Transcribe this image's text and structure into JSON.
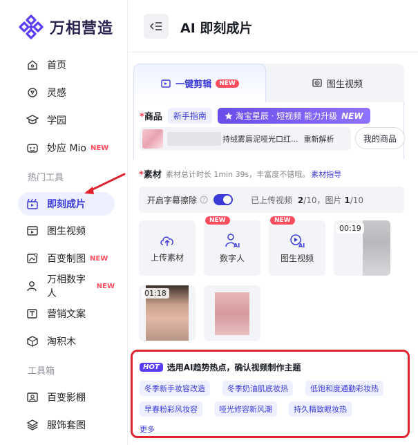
{
  "brand": {
    "name": "万相营造",
    "accent": "#3b3bd8"
  },
  "sidebar": {
    "items": [
      {
        "label": "首页",
        "icon": "home-icon"
      },
      {
        "label": "灵感",
        "icon": "bulb-icon"
      },
      {
        "label": "学园",
        "icon": "graduation-icon"
      },
      {
        "label": "妙应 Mio",
        "icon": "robot-icon",
        "badge": "NEW"
      }
    ],
    "section_hot": "热门工具",
    "hot_items": [
      {
        "label": "即刻成片",
        "icon": "clapper-icon",
        "active": true
      },
      {
        "label": "图生视频",
        "icon": "image-video-icon"
      },
      {
        "label": "百变制图",
        "icon": "image-edit-icon",
        "badge": "NEW"
      },
      {
        "label": "万相数字人",
        "icon": "person-icon",
        "badge": "NEW"
      },
      {
        "label": "营销文案",
        "icon": "text-icon"
      },
      {
        "label": "淘积木",
        "icon": "cube-icon"
      }
    ],
    "section_tools": "工具箱",
    "tool_items": [
      {
        "label": "百变影棚",
        "icon": "studio-icon"
      },
      {
        "label": "服饰套图",
        "icon": "layers-icon"
      }
    ]
  },
  "header": {
    "title": "AI 即刻成片"
  },
  "tabs": [
    {
      "label": "一键剪辑",
      "badge": "NEW"
    },
    {
      "label": "图生视频"
    }
  ],
  "goods": {
    "label": "商品",
    "guide": "新手指南",
    "promo": "淘宝星辰 · 短视频 能力升级",
    "promo_badge": "NEW",
    "product_name": "持绒雾唇泥哑光口红...",
    "reparse": "重新解析",
    "my_goods": "我的商品"
  },
  "material": {
    "label": "素材",
    "hint": "素材总计时长 1min 39s，丰富度不错哦。",
    "link": "素材指导",
    "subtitle_toggle": "开启字幕擦除",
    "uploaded_prefix": "已上传视频",
    "video_count": "2",
    "video_total": "/10，图片",
    "image_count": "1",
    "image_total": "/10"
  },
  "tiles": [
    {
      "label": "上传素材"
    },
    {
      "label": "数字人",
      "badge": "NEW"
    },
    {
      "label": "图生视频",
      "badge": "NEW"
    }
  ],
  "videos": [
    {
      "duration": "00:19"
    },
    {
      "duration": "01:18"
    },
    {
      "duration": ""
    }
  ],
  "hot": {
    "badge": "HOT",
    "title": "选用AI趋势热点，确认视频制作主题",
    "tags": [
      "冬季新手妆容改造",
      "冬季奶油肌底妆热",
      "低饱和度通勤彩妆热",
      "早春粉彩风妆容",
      "哑光修容新风潮",
      "持久精致眼妆热"
    ],
    "more": "更多"
  }
}
